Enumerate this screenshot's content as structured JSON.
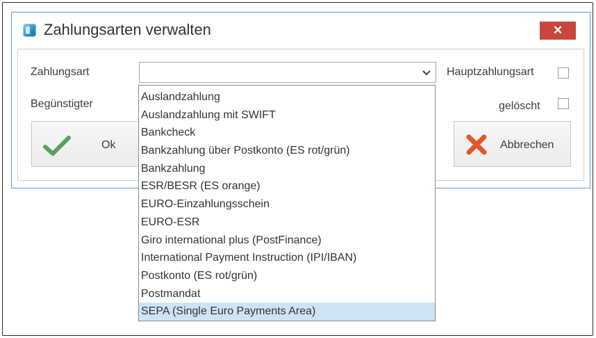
{
  "dialog": {
    "title": "Zahlungsarten verwalten",
    "close_symbol": "✕",
    "icon": "app-icon",
    "labels": {
      "zahlungsart": "Zahlungsart",
      "beguenstigter": "Begünstigter",
      "hauptzahlungsart": "Hauptzahlungsart",
      "geloescht": "gelöscht"
    },
    "combo": {
      "value": "",
      "arrow_icon": "chevron-down-icon"
    },
    "checkboxes": {
      "hauptzahlungsart": false,
      "geloescht": false
    },
    "buttons": {
      "ok": {
        "label": "Ok",
        "icon": "checkmark-icon",
        "color": "#5aa15a"
      },
      "abbrechen": {
        "label": "Abbrechen",
        "icon": "cross-icon",
        "color": "#e0572b"
      }
    },
    "colors": {
      "border_accent": "#5b9bd5",
      "close_bg": "#c9463d",
      "selection": "#cde4f7"
    }
  },
  "dropdown": {
    "items": [
      {
        "label": "Auslandzahlung"
      },
      {
        "label": "Auslandzahlung mit SWIFT"
      },
      {
        "label": "Bankcheck"
      },
      {
        "label": "Bankzahlung über Postkonto (ES rot/grün)"
      },
      {
        "label": "Bankzahlung"
      },
      {
        "label": "ESR/BESR (ES orange)"
      },
      {
        "label": "EURO-Einzahlungsschein"
      },
      {
        "label": "EURO-ESR"
      },
      {
        "label": "Giro international plus (PostFinance)"
      },
      {
        "label": "International Payment Instruction (IPI/IBAN)"
      },
      {
        "label": "Postkonto (ES rot/grün)"
      },
      {
        "label": "Postmandat"
      },
      {
        "label": "SEPA (Single Euro Payments Area)"
      }
    ],
    "highlighted_index": 12
  }
}
